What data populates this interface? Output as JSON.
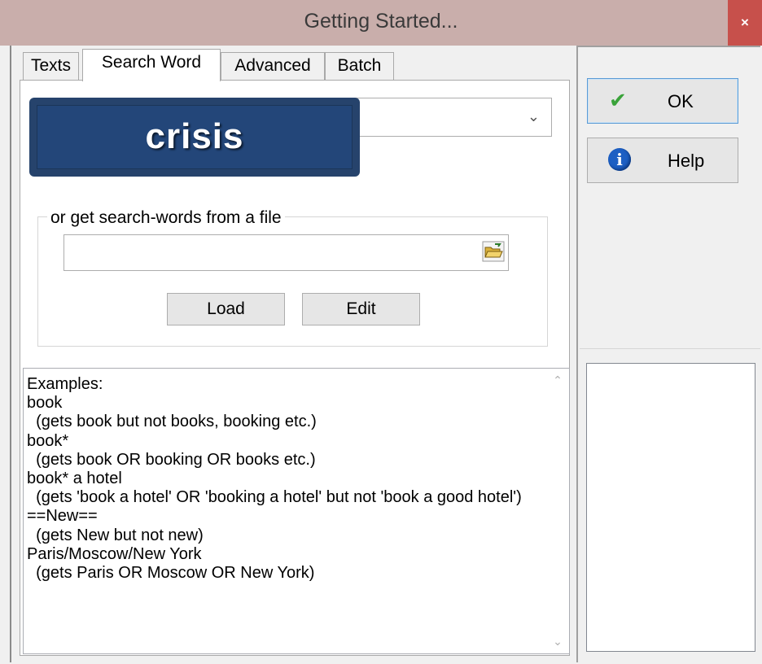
{
  "window": {
    "title": "Getting Started...",
    "close_label": "×"
  },
  "tabs": [
    {
      "label": "Texts",
      "active": false
    },
    {
      "label": "Search Word",
      "active": true
    },
    {
      "label": "Advanced",
      "active": false
    },
    {
      "label": "Batch",
      "active": false
    }
  ],
  "search_word": {
    "value": "crisis",
    "dropdown_icon": "chevron-down-icon"
  },
  "file_group": {
    "legend": "or get search-words from a file",
    "file_path": "",
    "browse_icon": "folder-open-icon",
    "load_label": "Load",
    "edit_label": "Edit"
  },
  "examples": {
    "text": "Examples:\nbook\n  (gets book but not books, booking etc.)\nbook*\n  (gets book OR booking OR books etc.)\nbook* a hotel\n  (gets 'book a hotel' OR 'booking a hotel' but not 'book a good hotel')\n==New==\n  (gets New but not new)\nParis/Moscow/New York\n  (gets Paris OR Moscow OR New York)"
  },
  "buttons": {
    "ok_label": "OK",
    "ok_icon": "checkmark-icon",
    "help_label": "Help",
    "help_icon": "info-icon"
  },
  "colors": {
    "titlebar": "#c9aeab",
    "close": "#c7504b",
    "badge": "#234679"
  }
}
